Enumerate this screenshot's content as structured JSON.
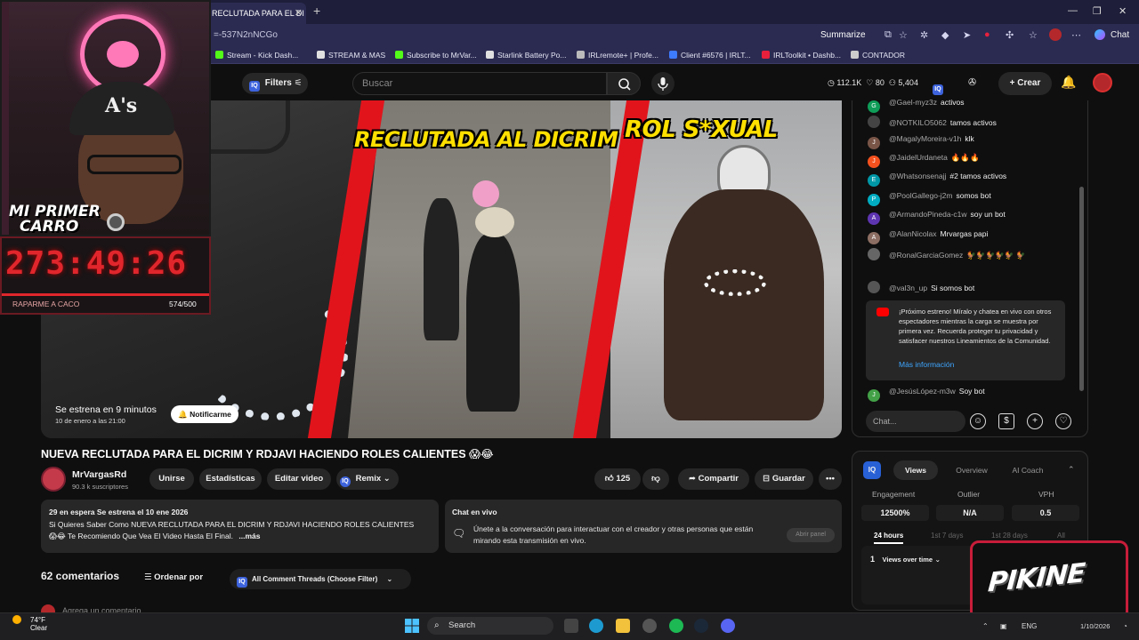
{
  "browser": {
    "tab_title": "RECLUTADA PARA EL DI",
    "tab_close": "✕",
    "new_tab": "+",
    "url": "=-537N2nNCGo",
    "summarize": "Summarize",
    "chat_label": "Chat",
    "window_controls": [
      "—",
      "❐",
      "✕"
    ],
    "bookmarks": [
      {
        "label": "Stream - Kick Dash...",
        "color": "#53fc18"
      },
      {
        "label": "STREAM & MAS",
        "color": "#e0e0e0"
      },
      {
        "label": "Subscribe to MrVar...",
        "color": "#53fc18"
      },
      {
        "label": "Starlink Battery Po...",
        "color": "#e0e0e0"
      },
      {
        "label": "IRLremote+ | Profe...",
        "color": "#bbbbbb"
      },
      {
        "label": "Client #6576 | IRLT...",
        "color": "#3d7bff"
      },
      {
        "label": "IRLToolkit • Dashb...",
        "color": "#e8203c"
      },
      {
        "label": "CONTADOR",
        "color": "#cccccc"
      }
    ]
  },
  "yt": {
    "filters_label": "Filters",
    "iq": "IQ",
    "search_placeholder": "Buscar",
    "stats": {
      "views": "112.1K",
      "likes": "80",
      "subs": "5,404"
    },
    "create_label": "Crear"
  },
  "video": {
    "thumb_text_1": "RECLUTADA AL DICRIM",
    "thumb_text_2": "ROL S*XUAL",
    "premiere_label": "Se estrena en 9 minutos",
    "premiere_date": "10 de enero a las 21:00",
    "notify_label": "Notificarme",
    "title": "NUEVA RECLUTADA PARA EL DICRIM Y RDJAVI HACIENDO ROLES CALIENTES 😱😂"
  },
  "overlay": {
    "cap_logo": "A's",
    "banner_1": "MI PRIMER",
    "banner_2": "CARRO",
    "timer": "273:49:26",
    "goal_label": "RAPARME A CACO",
    "goal_count": "574/500"
  },
  "channel": {
    "name": "MrVargasRd",
    "subs": "90.3 k suscriptores",
    "join": "Unirse",
    "stats": "Estadísticas",
    "edit": "Editar video",
    "remix": "Remix",
    "likes": "125",
    "share": "Compartir",
    "save": "Guardar",
    "more": "•••"
  },
  "description": {
    "meta": "29 en espera  Se estrena el 10 ene 2026",
    "line1": "Si Quieres Saber Como NUEVA RECLUTADA PARA EL DICRIM Y RDJAVI HACIENDO ROLES CALIENTES",
    "line2": "😱😂 Te Recomiendo Que Vea El Video Hasta El Final.",
    "more": "...más"
  },
  "chat_vivo": {
    "title": "Chat en vivo",
    "text": "Únete a la conversación para interactuar con el creador y otras personas que están mirando esta transmisión en vivo.",
    "button": "Abrir panel"
  },
  "comments": {
    "count": "62 comentarios",
    "order": "Ordenar por",
    "thread_filter": "All Comment Threads (Choose Filter)",
    "add_placeholder": "Agrega un comentario..."
  },
  "live_chat": {
    "messages": [
      {
        "user": "@Gael-myz3z",
        "text": "activos",
        "color": "#0f9d58",
        "initial": "G"
      },
      {
        "user": "@NOTKILO5062",
        "text": "tamos activos",
        "color": "#444444",
        "initial": ""
      },
      {
        "user": "@MagalyMoreira-v1h",
        "text": "klk",
        "color": "#795548",
        "initial": "J"
      },
      {
        "user": "@JaidelUrdaneta",
        "text": "🔥🔥🔥",
        "color": "#f4511e",
        "initial": "J"
      },
      {
        "user": "@Whatsonsenajj",
        "text": "#2  tamos activos",
        "color": "#0097a7",
        "initial": "E"
      },
      {
        "user": "@PoolGallego-j2m",
        "text": "somos bot",
        "color": "#00acc1",
        "initial": "P"
      },
      {
        "user": "@ArmandoPineda-c1w",
        "text": "soy un bot",
        "color": "#5e35b1",
        "initial": "A"
      },
      {
        "user": "@AlanNicolax",
        "text": "Mrvargas papi",
        "color": "#8d6e63",
        "initial": "A"
      },
      {
        "user": "@RonalGarciaGomez",
        "text": "🐓🐓🐓🐓🐓 🐓",
        "color": "#666666",
        "initial": ""
      },
      {
        "user": "@val3n_up",
        "text": "Si somos bot",
        "color": "#555555",
        "initial": ""
      }
    ],
    "notice": "¡Próximo estreno! Míralo y chatea en vivo con otros espectadores mientras la carga se muestra por primera vez. Recuerda proteger tu privacidad y satisfacer nuestros Lineamientos de la Comunidad.",
    "notice_link": "Más información",
    "last_msg": {
      "user": "@JesúsLópez-m3w",
      "text": "Soy bot",
      "color": "#43a047",
      "initial": "J"
    },
    "input_placeholder": "Chat..."
  },
  "iq_panel": {
    "badge": "IQ",
    "tabs": [
      "Views",
      "Overview",
      "AI Coach"
    ],
    "labels": [
      "Engagement",
      "Outlier",
      "VPH"
    ],
    "values": [
      "12500%",
      "N/A",
      "0.5"
    ],
    "ranges": [
      "24 hours",
      "1st 7 days",
      "1st 28 days",
      "All"
    ],
    "metric_rank": "1",
    "metric": "Views over time"
  },
  "logo_text": "PIKINE",
  "taskbar": {
    "temp": "74°F",
    "condition": "Clear",
    "search": "Search",
    "lang": "ENG",
    "date": "1/10/2026"
  }
}
